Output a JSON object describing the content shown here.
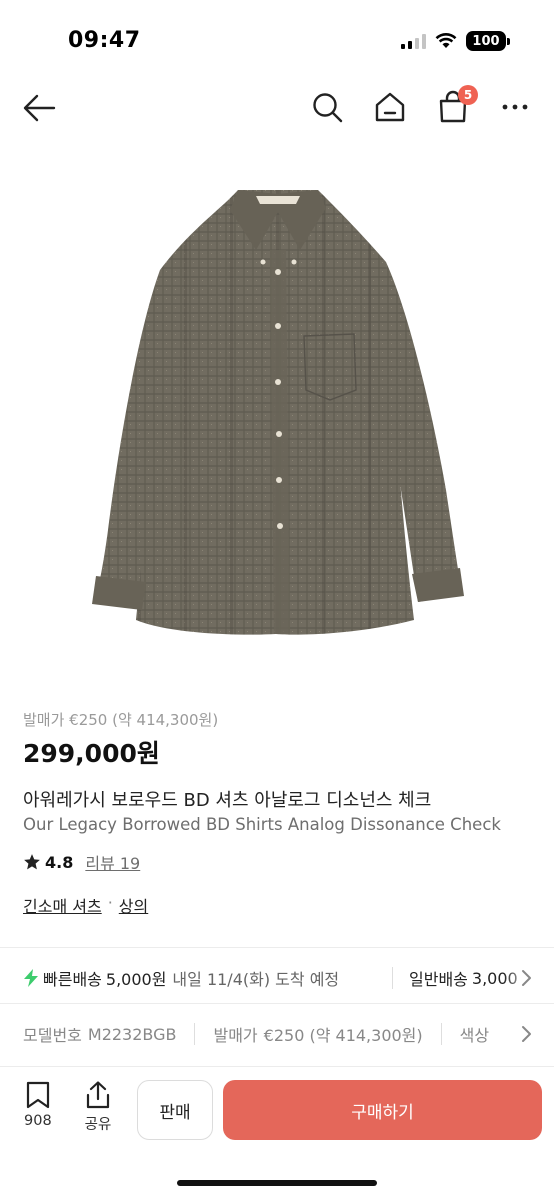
{
  "status_bar": {
    "time": "09:47",
    "battery": "100"
  },
  "nav": {
    "cart_count": "5"
  },
  "product": {
    "original_price": "발매가 €250 (약 414,300원)",
    "price": "299,000원",
    "name_ko": "아워레가시 보로우드 BD 셔츠 아날로그 디소넌스 체크",
    "name_en": "Our Legacy Borrowed BD Shirts Analog Dissonance Check",
    "rating": "4.8",
    "review_label": "리뷰 19",
    "categories": [
      "긴소매 셔츠",
      "상의"
    ],
    "category_sep": "·"
  },
  "delivery": {
    "fast_label": "빠른배송",
    "fast_fee": "5,000원",
    "fast_arrival": "내일 11/4(화) 도착 예정",
    "standard_label": "일반배송",
    "standard_fee": "3,000"
  },
  "specs": {
    "model_label": "모델번호",
    "model_value": "M2232BGB",
    "release_label": "발매가",
    "release_value": "€250 (약 414,300원)",
    "color_label": "색상"
  },
  "bottom_bar": {
    "bookmark_count": "908",
    "share_label": "공유",
    "sell_label": "판매",
    "buy_label": "구매하기"
  },
  "colors": {
    "accent": "#e4675a",
    "badge": "#ef6253",
    "bolt": "#3dcc6d",
    "shirt": "#6f6a5f"
  },
  "icons": [
    "back-arrow-icon",
    "search-icon",
    "home-icon",
    "shopping-bag-icon",
    "more-icon",
    "star-icon",
    "bolt-icon",
    "chevron-right-icon",
    "bookmark-icon",
    "share-icon"
  ]
}
